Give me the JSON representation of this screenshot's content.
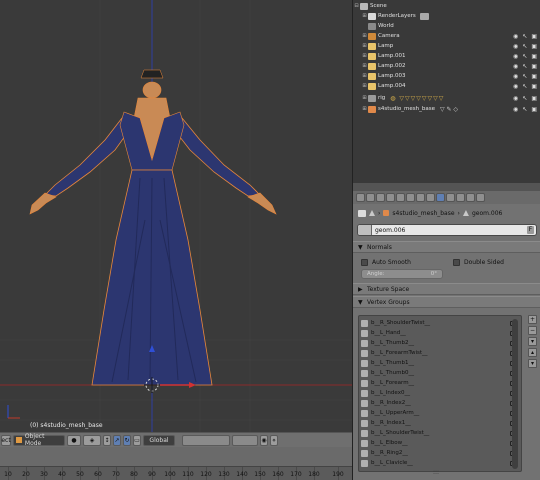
{
  "viewport": {
    "object_label": "(0) s4studio_mesh_base"
  },
  "view_header": {
    "mode_label": "Object Mode",
    "orientation_label": "Global"
  },
  "timeline": {
    "ticks": [
      "10",
      "20",
      "30",
      "40",
      "50",
      "60",
      "70",
      "80",
      "90",
      "100",
      "110",
      "120",
      "130",
      "140",
      "150",
      "160",
      "170",
      "180",
      "190"
    ]
  },
  "outliner": {
    "rows": [
      {
        "label": "Scene",
        "indent": 0,
        "icon": "scene-icon"
      },
      {
        "label": "RenderLayers",
        "indent": 1,
        "icon": "render-layers-icon"
      },
      {
        "label": "World",
        "indent": 1,
        "icon": "world-icon"
      },
      {
        "label": "Camera",
        "indent": 1,
        "icon": "camera-icon"
      },
      {
        "label": "Lamp",
        "indent": 1,
        "icon": "lamp-icon"
      },
      {
        "label": "Lamp.001",
        "indent": 1,
        "icon": "lamp-icon"
      },
      {
        "label": "Lamp.002",
        "indent": 1,
        "icon": "lamp-icon"
      },
      {
        "label": "Lamp.003",
        "indent": 1,
        "icon": "lamp-icon"
      },
      {
        "label": "Lamp.004",
        "indent": 1,
        "icon": "lamp-icon"
      },
      {
        "label": "rig",
        "indent": 1,
        "icon": "armature-icon"
      },
      {
        "label": "s4studio_mesh_base",
        "indent": 1,
        "icon": "mesh-icon"
      }
    ]
  },
  "properties": {
    "context_object": "s4studio_mesh_base",
    "context_data": "geom.006",
    "mesh_name": "geom.006",
    "normals": {
      "title": "Normals",
      "auto_smooth": "Auto Smooth",
      "double_sided": "Double Sided",
      "angle_label": "Angle:",
      "angle_value": "0°"
    },
    "texture_space": {
      "title": "Texture Space"
    },
    "vertex_groups": {
      "title": "Vertex Groups",
      "items": [
        "b__R_ShoulderTwist__",
        "b__L_Hand__",
        "b__L_Thumb2__",
        "b__L_ForearmTwist__",
        "b__L_Thumb1__",
        "b__L_Thumb0__",
        "b__L_Forearm__",
        "b__L_Index0__",
        "b__R_Index2__",
        "b__L_UpperArm__",
        "b__R_Index1__",
        "b__L_ShoulderTwist__",
        "b__L_Elbow__",
        "b__R_Ring2__",
        "b__L_Clavicle__"
      ]
    }
  },
  "colors": {
    "dress": "#2c3670",
    "viewport_bg": "#3a3a3a",
    "active_tab": "#5f7fb3",
    "x_axis": "#c0392b",
    "z_axis": "#2f4fd6"
  }
}
